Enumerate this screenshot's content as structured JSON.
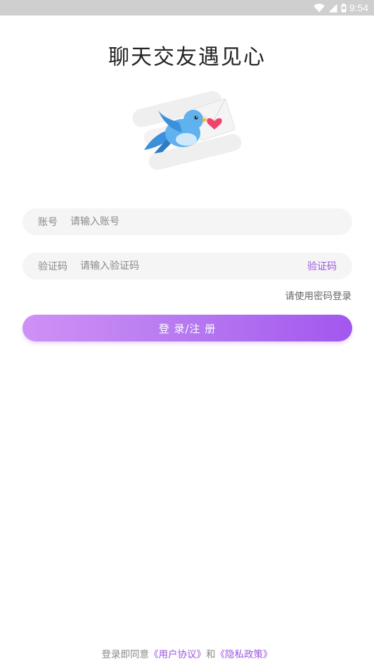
{
  "status_bar": {
    "time": "9:54",
    "icons": [
      "wifi-icon",
      "signal-icon",
      "battery-icon"
    ]
  },
  "app": {
    "title": "聊天交友遇见心"
  },
  "hero": {
    "illustration": "bird-with-love-letter"
  },
  "form": {
    "account": {
      "label": "账号",
      "placeholder": "请输入账号",
      "value": ""
    },
    "code": {
      "label": "验证码",
      "placeholder": "请输入验证码",
      "value": "",
      "get_code_label": "验证码"
    },
    "switch_login": "请使用密码登录",
    "submit_label": "登 录/注 册"
  },
  "agreement": {
    "prefix": "登录即同意",
    "user_agreement": "《用户协议》",
    "conjunction": "和",
    "privacy_policy": "《隐私政策》"
  },
  "colors": {
    "accent": "#9b55e0",
    "button_start": "#cf91f4",
    "button_end": "#a257ee",
    "status_bar": "#cfcfcf"
  }
}
